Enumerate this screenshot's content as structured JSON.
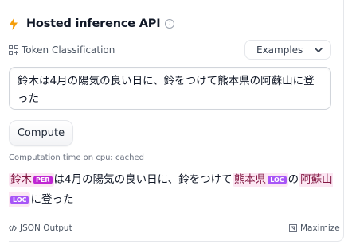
{
  "widget": {
    "title": "Hosted inference API",
    "task_label": "Token Classification",
    "examples_label": "Examples",
    "input_text": "鈴木は4月の陽気の良い日に、鈴をつけて熊本県の阿蘇山に登った",
    "compute_label": "Compute",
    "computation_time": "Computation time on cpu: cached",
    "output": [
      {
        "text": "鈴木",
        "tag": "PER"
      },
      {
        "text": "は4月の陽気の良い日に、鈴をつけて"
      },
      {
        "text": "熊本県",
        "tag": "LOC"
      },
      {
        "text": "の"
      },
      {
        "text": "阿蘇山",
        "tag": "LOC"
      },
      {
        "text": "に登った"
      }
    ],
    "json_output_label": "JSON Output",
    "maximize_label": "Maximize"
  },
  "icons": {
    "bolt": "lightning-icon",
    "info": "info-icon",
    "task": "token-classification-icon",
    "chevron": "chevron-down-icon",
    "code": "code-icon",
    "maximize": "maximize-icon"
  },
  "colors": {
    "bolt": "#f59e0b",
    "entity_bg": "#fce7f3",
    "per_tag": "#c026d3",
    "loc_tag": "#a855f7"
  }
}
